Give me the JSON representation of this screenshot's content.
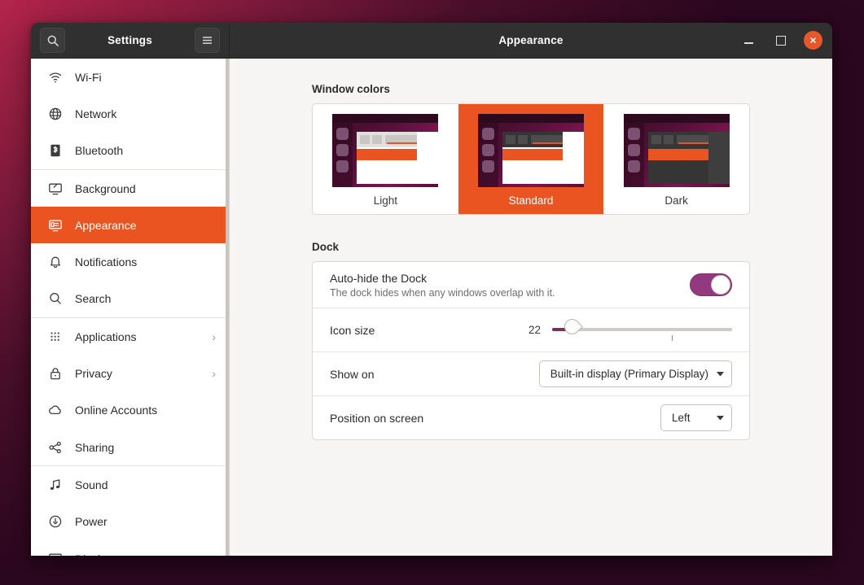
{
  "window": {
    "app_title": "Settings",
    "page_title": "Appearance",
    "search_icon": "search-icon",
    "menu_icon": "hamburger-menu-icon",
    "minimize_label": "minimize",
    "maximize_label": "maximize",
    "close_label": "close",
    "accent_color": "#e95420",
    "titlebar_color": "#303030"
  },
  "sidebar": {
    "items": [
      {
        "label": "Wi-Fi",
        "icon": "wifi-icon",
        "selected": false,
        "chevron": false
      },
      {
        "label": "Network",
        "icon": "network-globe-icon",
        "selected": false,
        "chevron": false
      },
      {
        "label": "Bluetooth",
        "icon": "bluetooth-icon",
        "selected": false,
        "chevron": false
      },
      {
        "label": "Background",
        "icon": "background-icon",
        "selected": false,
        "chevron": false
      },
      {
        "label": "Appearance",
        "icon": "appearance-icon",
        "selected": true,
        "chevron": false
      },
      {
        "label": "Notifications",
        "icon": "bell-icon",
        "selected": false,
        "chevron": false
      },
      {
        "label": "Search",
        "icon": "search-icon",
        "selected": false,
        "chevron": false
      },
      {
        "label": "Applications",
        "icon": "applications-grid-icon",
        "selected": false,
        "chevron": true
      },
      {
        "label": "Privacy",
        "icon": "lock-icon",
        "selected": false,
        "chevron": true
      },
      {
        "label": "Online Accounts",
        "icon": "cloud-icon",
        "selected": false,
        "chevron": false
      },
      {
        "label": "Sharing",
        "icon": "share-icon",
        "selected": false,
        "chevron": false
      },
      {
        "label": "Sound",
        "icon": "music-note-icon",
        "selected": false,
        "chevron": false
      },
      {
        "label": "Power",
        "icon": "power-icon",
        "selected": false,
        "chevron": false
      },
      {
        "label": "Displays",
        "icon": "displays-icon",
        "selected": false,
        "chevron": false
      }
    ],
    "separators_after": [
      2,
      6,
      10
    ],
    "chevron_glyph": "›"
  },
  "main": {
    "window_colors": {
      "heading": "Window colors",
      "options": [
        {
          "label": "Light",
          "selected": false,
          "variant": "light"
        },
        {
          "label": "Standard",
          "selected": true,
          "variant": "standard"
        },
        {
          "label": "Dark",
          "selected": false,
          "variant": "dark"
        }
      ]
    },
    "dock": {
      "heading": "Dock",
      "autohide": {
        "title": "Auto-hide the Dock",
        "subtitle": "The dock hides when any windows overlap with it.",
        "enabled": true,
        "toggle_color": "#92397f"
      },
      "icon_size": {
        "title": "Icon size",
        "value": "22"
      },
      "show_on": {
        "title": "Show on",
        "value": "Built-in display (Primary Display)"
      },
      "position_on_screen": {
        "title": "Position on screen",
        "value": "Left"
      }
    }
  }
}
